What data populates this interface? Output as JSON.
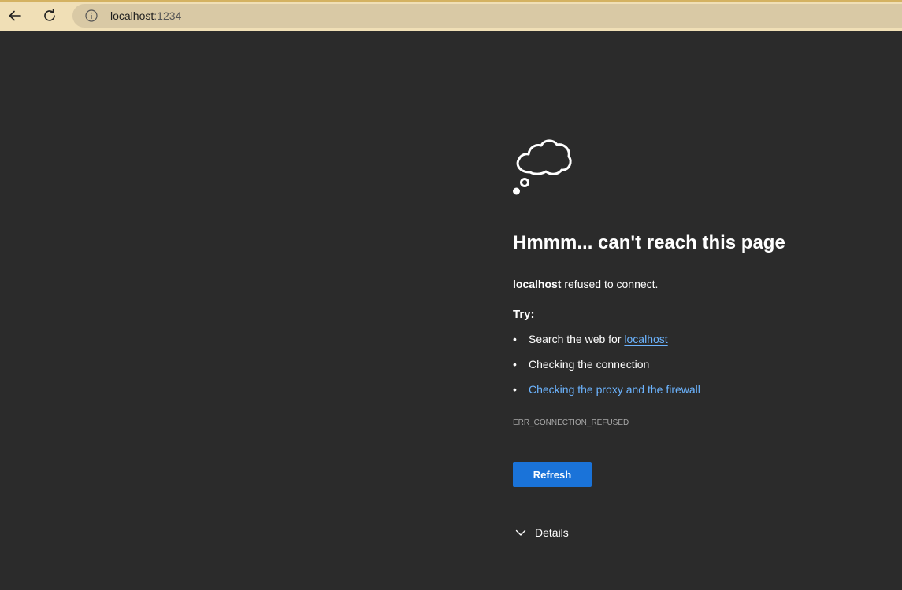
{
  "browser": {
    "url_host": "localhost",
    "url_port": ":1234",
    "icons": {
      "back": "back-arrow-icon",
      "refresh": "refresh-icon",
      "info": "info-icon"
    }
  },
  "error_page": {
    "icon": "thought-bubble-icon",
    "heading": "Hmmm... can't reach this page",
    "message_host": "localhost",
    "message_text": " refused to connect.",
    "try_label": "Try:",
    "suggestions": [
      {
        "prefix": "Search the web for ",
        "link": "localhost"
      },
      {
        "text": "Checking the connection"
      },
      {
        "link": "Checking the proxy and the firewall"
      }
    ],
    "error_code": "ERR_CONNECTION_REFUSED",
    "refresh_label": "Refresh",
    "details_label": "Details"
  },
  "colors": {
    "page_background": "#2b2b2b",
    "toolbar_background": "#f0dfb6",
    "link": "#6cb4ff",
    "button": "#1a73d9"
  }
}
